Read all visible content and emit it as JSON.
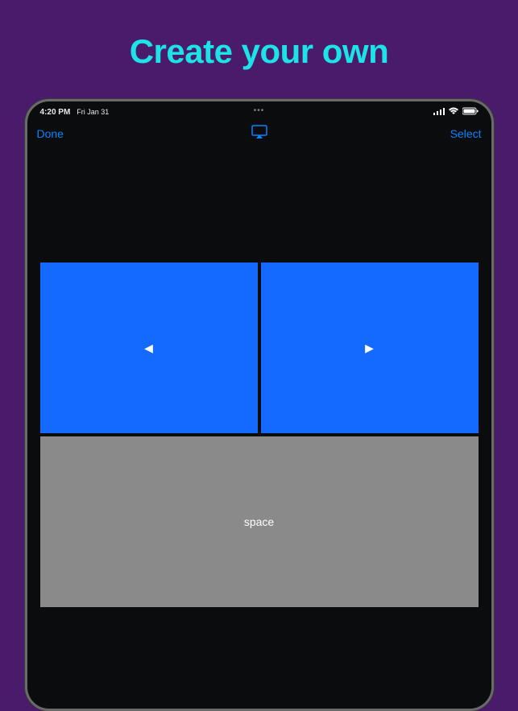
{
  "marketing": {
    "title": "Create your own"
  },
  "statusBar": {
    "time": "4:20 PM",
    "date": "Fri Jan 31",
    "menu": "•••"
  },
  "navBar": {
    "done": "Done",
    "select": "Select"
  },
  "buttons": {
    "left": "◀",
    "right": "▶",
    "space": "space"
  }
}
